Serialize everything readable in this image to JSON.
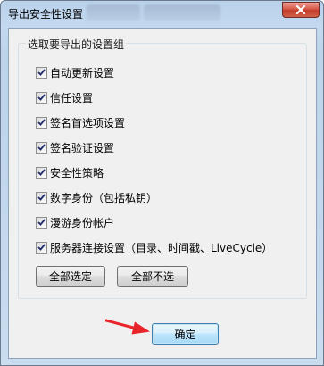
{
  "window": {
    "title": "导出安全性设置",
    "close_icon": "close-icon"
  },
  "group": {
    "label": "选取要导出的设置组",
    "items": [
      {
        "label": "自动更新设置",
        "checked": true
      },
      {
        "label": "信任设置",
        "checked": true
      },
      {
        "label": "签名首选项设置",
        "checked": true
      },
      {
        "label": "签名验证设置",
        "checked": true
      },
      {
        "label": "安全性策略",
        "checked": true
      },
      {
        "label": "数字身份（包括私钥）",
        "checked": true
      },
      {
        "label": "漫游身份帐户",
        "checked": true
      },
      {
        "label": "服务器连接设置（目录、时间戳、LiveCycle）",
        "checked": true
      }
    ],
    "select_all_label": "全部选定",
    "deselect_all_label": "全部不选"
  },
  "ok_label": "确定",
  "colors": {
    "titlebar": "#c4d9ef",
    "client": "#f0f0f0",
    "close_button": "#c23b29",
    "arrow": "#e8242a"
  }
}
